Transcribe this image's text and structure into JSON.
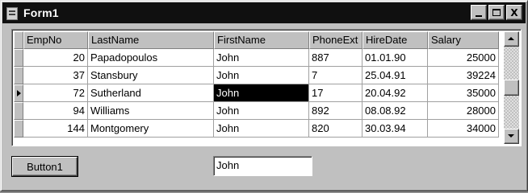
{
  "window": {
    "title": "Form1",
    "controls": {
      "minimize": "_",
      "maximize": "□",
      "close": "X"
    }
  },
  "grid": {
    "columns": [
      "EmpNo",
      "LastName",
      "FirstName",
      "PhoneExt",
      "HireDate",
      "Salary"
    ],
    "rows": [
      [
        "20",
        "Papadopoulos",
        "John",
        "887",
        "01.01.90",
        "25000"
      ],
      [
        "37",
        "Stansbury",
        "John",
        "7",
        "25.04.91",
        "39224"
      ],
      [
        "72",
        "Sutherland",
        "John",
        "17",
        "20.04.92",
        "35000"
      ],
      [
        "94",
        "Williams",
        "John",
        "892",
        "08.08.92",
        "28000"
      ],
      [
        "144",
        "Montgomery",
        "John",
        "820",
        "30.03.94",
        "34000"
      ]
    ],
    "current_row": 2,
    "selected_column": 2
  },
  "button1": {
    "label": "Button1"
  },
  "edit1": {
    "value": "John"
  },
  "colors": {
    "titlebar": "#101010",
    "face": "#c0c0c0",
    "selection": "#000000"
  }
}
